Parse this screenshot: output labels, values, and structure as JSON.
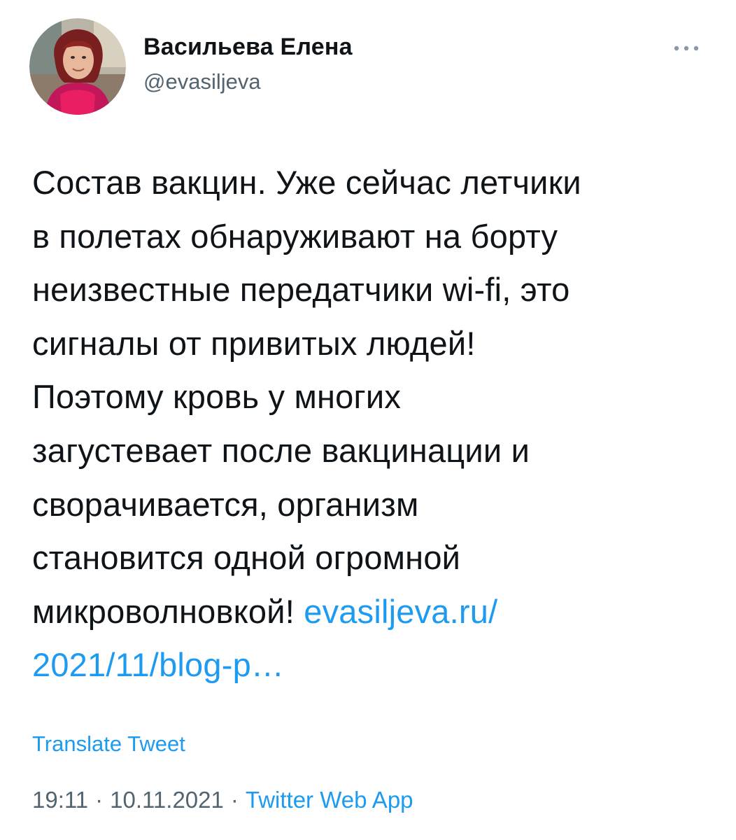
{
  "author": {
    "name": "Васильева Елена",
    "handle": "@evasiljeva"
  },
  "tweet": {
    "text": "Состав вакцин. Уже сейчас летчики\nв полетах обнаруживают на борту\nнеизвестные передатчики wi-fi, это\nсигналы от привитых людей!\nПоэтому кровь у многих\nзагустевает после вакцинации и\nсворачивается, организм\nстановится одной огромной\nмикроволновкой! ",
    "link_text": "evasiljeva.ru/\n2021/11/blog-p…"
  },
  "translate_label": "Translate Tweet",
  "meta": {
    "time": "19:11",
    "separator": "·",
    "date": "10.11.2021",
    "source": "Twitter Web App"
  },
  "icons": {
    "more": "more-horizontal-icon"
  },
  "colors": {
    "link": "#1d9bf0",
    "secondary_text": "#536471",
    "primary_text": "#0f1419"
  }
}
